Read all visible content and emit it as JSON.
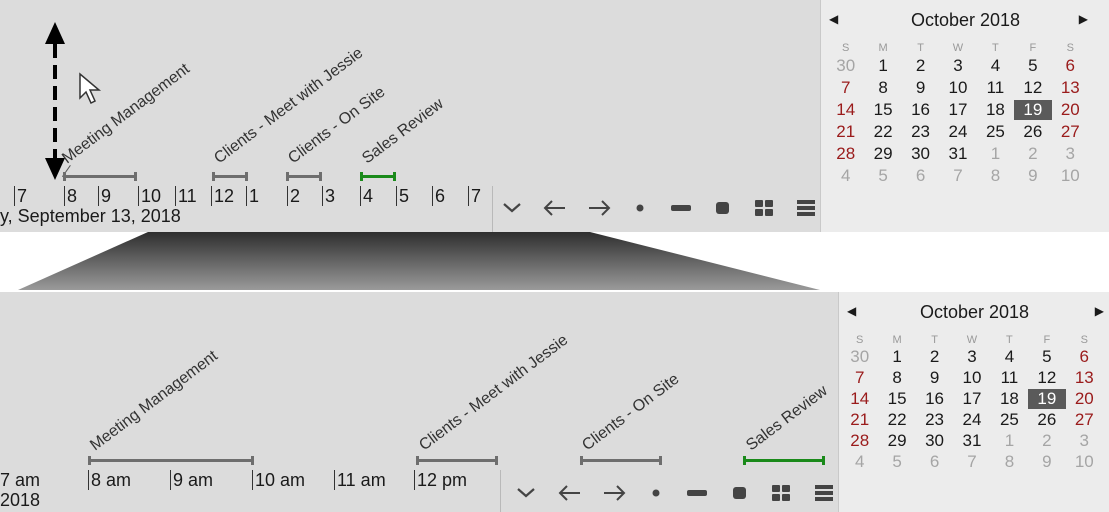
{
  "top": {
    "ticks": [
      "7",
      "8",
      "9",
      "10",
      "11",
      "12",
      "1",
      "2",
      "3",
      "4",
      "5",
      "6",
      "7"
    ],
    "date_line": "y, September 13, 2018",
    "events": [
      "Meeting Management",
      "Clients - Meet with Jessie",
      "Clients - On Site",
      "Sales Review"
    ]
  },
  "bottom": {
    "ticks": [
      "7 am",
      "8 am",
      "9 am",
      "10 am",
      "11 am",
      "12 pm"
    ],
    "date_line": "2018",
    "events": [
      "Meeting Management",
      "Clients - Meet with Jessie",
      "Clients - On Site",
      "Sales Review"
    ]
  },
  "toolbar_icons": [
    "chevron-down-icon",
    "arrow-left-icon",
    "arrow-right-icon",
    "dot-icon",
    "dash-icon",
    "square-icon",
    "grid-icon",
    "list-icon"
  ],
  "calendar": {
    "title": "October 2018",
    "dow": [
      "S",
      "M",
      "T",
      "W",
      "T",
      "F",
      "S"
    ],
    "weeks": [
      [
        "30",
        "1",
        "2",
        "3",
        "4",
        "5",
        "6"
      ],
      [
        "7",
        "8",
        "9",
        "10",
        "11",
        "12",
        "13"
      ],
      [
        "14",
        "15",
        "16",
        "17",
        "18",
        "19",
        "20"
      ],
      [
        "21",
        "22",
        "23",
        "24",
        "25",
        "26",
        "27"
      ],
      [
        "28",
        "29",
        "30",
        "31",
        "1",
        "2",
        "3"
      ],
      [
        "4",
        "5",
        "6",
        "7",
        "8",
        "9",
        "10"
      ]
    ],
    "selected": "19"
  },
  "colors": {
    "panel": "#dcdcdc",
    "weekend": "#9a1b1b",
    "selected": "#5a5a5a",
    "green_event": "#1a8a1a"
  }
}
